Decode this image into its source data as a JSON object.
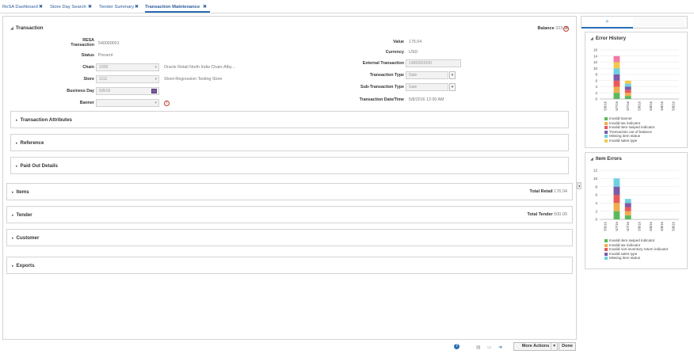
{
  "tabs": [
    {
      "label": "ReSA Dashboard"
    },
    {
      "label": "Store Day Search"
    },
    {
      "label": "Tender Summary"
    },
    {
      "label": "Transaction Maintenance"
    }
  ],
  "tab_close_glyph": "✖",
  "transaction": {
    "title": "Transaction",
    "balance_label": "Balance",
    "balance_value": "323.96",
    "left": {
      "resa_line1": "RESA",
      "resa_line2": "Transaction",
      "resa_value": "540000001",
      "status_label": "Status",
      "status_value": "Present",
      "chain_label": "Chain",
      "chain_value": "1000",
      "chain_desc": "Oracle Retail North India Chain-Alby...",
      "store_label": "Store",
      "store_value": "1111",
      "store_desc": "Short-Regression Testing Store",
      "business_day_label": "Business Day",
      "business_day_value": "5/8/16",
      "banner_label": "Banner",
      "banner_value": ""
    },
    "right": {
      "value_label": "Value",
      "value_value": "176.04",
      "currency_label": "Currency",
      "currency_value": "USD",
      "external_label": "External Transaction",
      "external_value": "1480000000",
      "type_label": "Transaction Type",
      "type_value": "Sale",
      "subtype_label": "Sub-Transaction Type",
      "subtype_value": "Sale",
      "datetime_label": "Transaction Date/Time",
      "datetime_value": "5/8/2016 12:00 AM"
    }
  },
  "subsections": [
    {
      "title": "Transaction Attributes"
    },
    {
      "title": "Reference"
    },
    {
      "title": "Paid Out Details"
    }
  ],
  "sections": {
    "items": {
      "title": "Items",
      "total_label": "Total Retail",
      "total_value": "176.04"
    },
    "tender": {
      "title": "Tender",
      "total_label": "Total Tender",
      "total_value": "500.00"
    },
    "customer": {
      "title": "Customer"
    },
    "exports": {
      "title": "Exports"
    }
  },
  "footer": {
    "more_actions": "More Actions",
    "done": "Done"
  },
  "icons": [
    "caret-icon",
    "close-icon",
    "warning-icon",
    "calendar-icon",
    "chevron-down-icon",
    "help-icon",
    "print-icon",
    "search-icon"
  ],
  "chart_data": [
    {
      "type": "bar",
      "title": "Error History",
      "stacked": true,
      "categories": [
        "5/6/16",
        "5/7/16",
        "5/7/16",
        "5/8/16",
        "5/8/16",
        "5/8/16",
        "5/8/16"
      ],
      "ylim": [
        0,
        16
      ],
      "yticks": [
        0,
        2,
        4,
        6,
        8,
        10,
        12,
        14,
        16
      ],
      "series": [
        {
          "name": "Invalid banner",
          "color": "#5cb85c",
          "values": [
            0,
            2,
            1,
            0,
            0,
            0,
            0
          ]
        },
        {
          "name": "Invalid tax indicator",
          "color": "#f0ad4e",
          "values": [
            0,
            2,
            1,
            0,
            0,
            0,
            0
          ]
        },
        {
          "name": "Invalid item swiped indicator",
          "color": "#e85a5a",
          "values": [
            0,
            2,
            1,
            0,
            0,
            0,
            0
          ]
        },
        {
          "name": "Transaction out of balance",
          "color": "#7b5aa6",
          "values": [
            0,
            2,
            1,
            0,
            0,
            0,
            0
          ]
        },
        {
          "name": "Missing item status",
          "color": "#6fd0e0",
          "values": [
            0,
            2,
            1,
            0,
            0,
            0,
            0
          ]
        },
        {
          "name": "Invalid sales type",
          "color": "#f2c94c",
          "values": [
            0,
            2,
            1,
            0,
            0,
            0,
            0
          ]
        },
        {
          "name": "",
          "color": "#f27aa6",
          "values": [
            0,
            2,
            0,
            0,
            0,
            0,
            0
          ]
        }
      ],
      "grid": true
    },
    {
      "type": "bar",
      "title": "Item Errors",
      "stacked": true,
      "categories": [
        "5/6/16",
        "5/7/16",
        "5/7/16",
        "5/8/16",
        "5/8/16",
        "5/8/16",
        "5/8/16"
      ],
      "ylim": [
        0,
        12
      ],
      "yticks": [
        0,
        2,
        4,
        6,
        8,
        10,
        12
      ],
      "series": [
        {
          "name": "Invalid item swiped indicator",
          "color": "#5cb85c",
          "values": [
            0,
            2,
            1,
            0,
            0,
            0,
            0
          ]
        },
        {
          "name": "Invalid tax indicator",
          "color": "#f0ad4e",
          "values": [
            0,
            2,
            1,
            0,
            0,
            0,
            0
          ]
        },
        {
          "name": "Invalid non-inventory return indicator",
          "color": "#e85a5a",
          "values": [
            0,
            2,
            1,
            0,
            0,
            0,
            0
          ]
        },
        {
          "name": "Invalid sales type",
          "color": "#7b5aa6",
          "values": [
            0,
            2,
            1,
            0,
            0,
            0,
            0
          ]
        },
        {
          "name": "Missing item status",
          "color": "#6fd0e0",
          "values": [
            0,
            2,
            1,
            0,
            0,
            0,
            0
          ]
        }
      ],
      "grid": true
    }
  ]
}
